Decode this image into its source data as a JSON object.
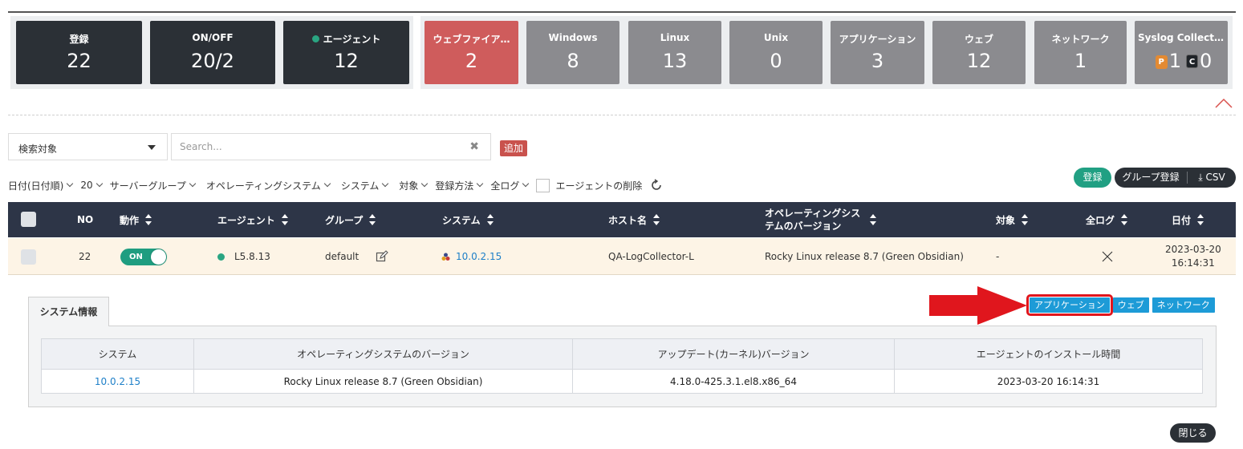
{
  "stats": {
    "registered": {
      "label": "登録",
      "value": "22"
    },
    "onoff": {
      "label": "ON/OFF",
      "value": "20/2"
    },
    "agent": {
      "label": "エージェント",
      "value": "12"
    },
    "categories": [
      {
        "label": "ウェブファイア…",
        "value": "2"
      },
      {
        "label": "Windows",
        "value": "8"
      },
      {
        "label": "Linux",
        "value": "13"
      },
      {
        "label": "Unix",
        "value": "0"
      },
      {
        "label": "アプリケーション",
        "value": "3"
      },
      {
        "label": "ウェブ",
        "value": "12"
      },
      {
        "label": "ネットワーク",
        "value": "1"
      }
    ],
    "syslog": {
      "label": "Syslog Collector",
      "p_badge": "P",
      "p_value": "1",
      "c_badge": "C",
      "c_value": "0"
    }
  },
  "search": {
    "target_label": "検索対象",
    "placeholder": "Search...",
    "clear": "✖",
    "add_label": "追加"
  },
  "filters": {
    "date_sort": "日付(日付順)",
    "page_size": "20",
    "server_group": "サーバーグループ",
    "os": "オペレーティングシステム",
    "system": "システム",
    "target": "対象",
    "reg_method": "登録方法",
    "all_logs": "全ログ",
    "delete_agent": "エージェントの削除"
  },
  "actions": {
    "register": "登録",
    "group_register": "グループ登録",
    "csv": "CSV"
  },
  "table": {
    "headers": {
      "no": "NO",
      "action": "動作",
      "agent": "エージェント",
      "group": "グループ",
      "system": "システム",
      "host": "ホスト名",
      "os_line1": "オペレーティングシス",
      "os_line2": "テムのバージョン",
      "target": "対象",
      "all_logs": "全ログ",
      "date": "日付"
    },
    "row": {
      "no": "22",
      "toggle": "ON",
      "agent_version": "L5.8.13",
      "group": "default",
      "system_ip": "10.0.2.15",
      "host": "QA-LogCollector-L",
      "os_version": "Rocky Linux release 8.7 (Green Obsidian)",
      "target": "-",
      "date_line1": "2023-03-20",
      "date_line2": "16:14:31"
    }
  },
  "detail": {
    "tab": "システム情報",
    "mini_tabs": [
      "アプリケーション",
      "ウェブ",
      "ネットワーク"
    ],
    "headers": [
      "システム",
      "オペレーティングシステムのバージョン",
      "アップデート(カーネル)バージョン",
      "エージェントのインストール時間"
    ],
    "row": {
      "system": "10.0.2.15",
      "os": "Rocky Linux release 8.7 (Green Obsidian)",
      "kernel": "4.18.0-425.3.1.el8.x86_64",
      "install_time": "2023-03-20 16:14:31"
    },
    "close": "閉じる"
  },
  "colors": {
    "dark_tile": "#2b3036",
    "gray_tile": "#8b8b8f",
    "alert_tile": "#cf5c5c",
    "header_bg": "#2d3547",
    "accent_green": "#21a083",
    "link_blue": "#1d7fc8",
    "annotation_red": "#e0161d"
  }
}
